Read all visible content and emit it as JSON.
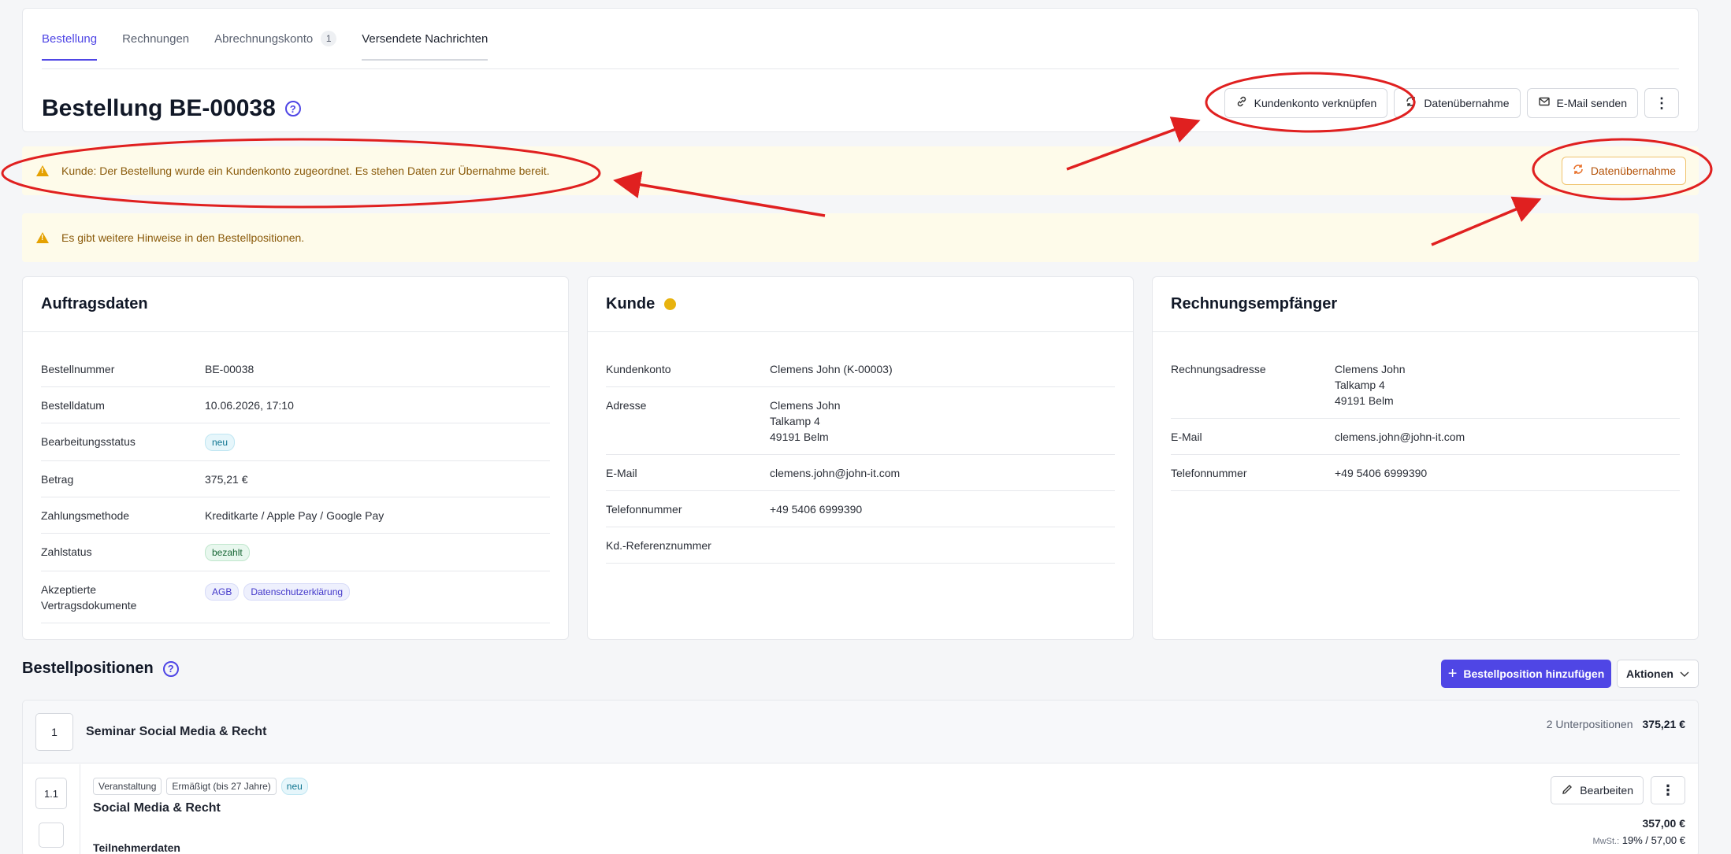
{
  "tabs": [
    {
      "label": "Bestellung"
    },
    {
      "label": "Rechnungen"
    },
    {
      "label": "Abrechnungskonto",
      "count": "1"
    },
    {
      "label": "Versendete Nachrichten"
    }
  ],
  "header": {
    "title": "Bestellung BE-00038",
    "help_icon": "?",
    "actions": {
      "link_customer": "Kundenkonto verknüpfen",
      "data_import": "Datenübernahme",
      "send_email": "E-Mail senden",
      "more": "⋮"
    }
  },
  "alerts": [
    {
      "text": "Kunde: Der Bestellung wurde ein Kundenkonto zugeordnet. Es stehen Daten zur Übernahme bereit.",
      "button": "Datenübernahme"
    },
    {
      "text": "Es gibt weitere Hinweise in den Bestellpositionen."
    }
  ],
  "order_data": {
    "title": "Auftragsdaten",
    "rows": [
      {
        "label": "Bestellnummer",
        "value": "BE-00038"
      },
      {
        "label": "Bestelldatum",
        "value": "10.06.2026, 17:10"
      },
      {
        "label": "Bearbeitungsstatus",
        "badge": "neu"
      },
      {
        "label": "Betrag",
        "value": "375,21 €"
      },
      {
        "label": "Zahlungsmethode",
        "value": "Kreditkarte / Apple Pay / Google Pay"
      },
      {
        "label": "Zahlstatus",
        "badge": "bezahlt"
      },
      {
        "label_line1": "Akzeptierte",
        "label_line2": "Vertragsdokumente",
        "badges": [
          "AGB",
          "Datenschutzerklärung"
        ]
      }
    ]
  },
  "customer": {
    "title": "Kunde",
    "rows": [
      {
        "label": "Kundenkonto",
        "value": "Clemens John (K-00003)"
      },
      {
        "label": "Adresse",
        "lines": [
          "Clemens John",
          "Talkamp 4",
          "49191 Belm"
        ]
      },
      {
        "label": "E-Mail",
        "value": "clemens.john@john-it.com"
      },
      {
        "label": "Telefonnummer",
        "value": "+49 5406 6999390"
      },
      {
        "label": "Kd.-Referenznummer",
        "value": ""
      }
    ]
  },
  "billing": {
    "title": "Rechnungsempfänger",
    "rows": [
      {
        "label": "Rechnungsadresse",
        "lines": [
          "Clemens John",
          "Talkamp 4",
          "49191 Belm"
        ]
      },
      {
        "label": "E-Mail",
        "value": "clemens.john@john-it.com"
      },
      {
        "label": "Telefonnummer",
        "value": "+49 5406 6999390"
      }
    ]
  },
  "positions": {
    "title": "Bestellpositionen",
    "add_button": "Bestellposition hinzufügen",
    "actions_button": "Aktionen",
    "group": {
      "number": "1",
      "title": "Seminar Social Media & Recht",
      "sub_count": "2 Unterpositionen",
      "total": "375,21 €"
    },
    "item": {
      "number": "1.1",
      "tags": [
        "Veranstaltung",
        "Ermäßigt (bis 27 Jahre)"
      ],
      "status_tag": "neu",
      "title": "Social Media & Recht",
      "section": "Teilnehmerdaten",
      "edit_button": "Bearbeiten",
      "price": "357,00 €",
      "tax_label": "MwSt.:",
      "tax_value": "19% / 57,00 €"
    }
  },
  "colors": {
    "accent": "#4f46e5",
    "alert_bg": "#fefbea",
    "warning": "#e5a100",
    "annotation": "#e02020"
  }
}
